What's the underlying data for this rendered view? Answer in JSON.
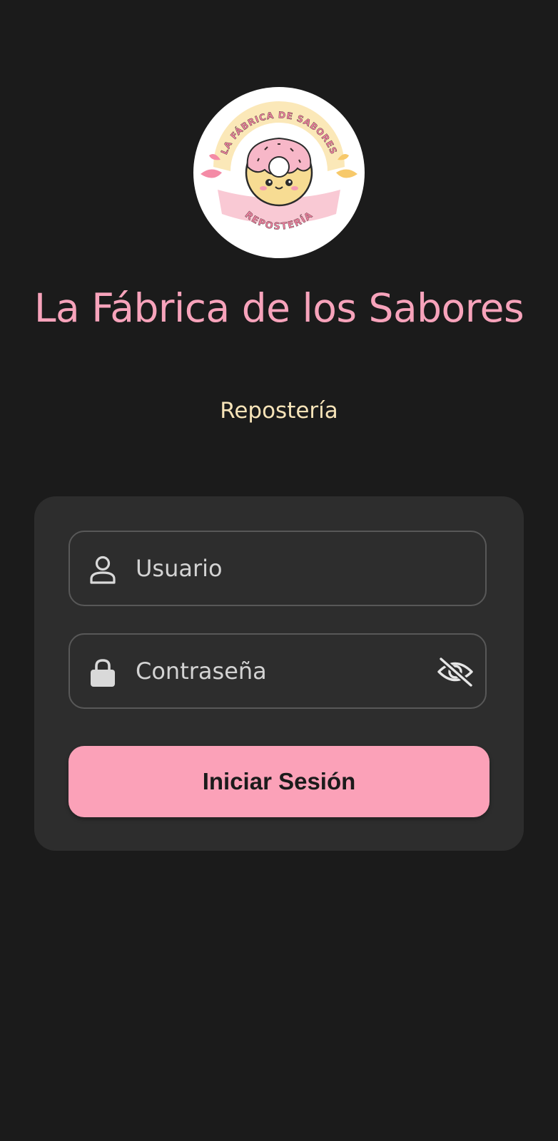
{
  "header": {
    "logo": {
      "arc_top_text": "LA FÁBRICA DE SABORES",
      "arc_bottom_text": "REPOSTERÍA",
      "icon": "donut-logo-icon"
    },
    "title": "La Fábrica de los Sabores",
    "subtitle": "Repostería"
  },
  "login_form": {
    "username": {
      "placeholder": "Usuario",
      "value": "",
      "icon": "user-icon"
    },
    "password": {
      "placeholder": "Contraseña",
      "value": "",
      "icon": "lock-icon",
      "visibility_icon": "eye-off-icon"
    },
    "submit_label": "Iniciar Sesión"
  },
  "colors": {
    "background": "#1b1b1b",
    "card": "#2d2d2d",
    "title_pink": "#f7a3bb",
    "subtitle_cream": "#f6e3b8",
    "button_pink": "#fba1b8",
    "field_border": "#585858"
  }
}
